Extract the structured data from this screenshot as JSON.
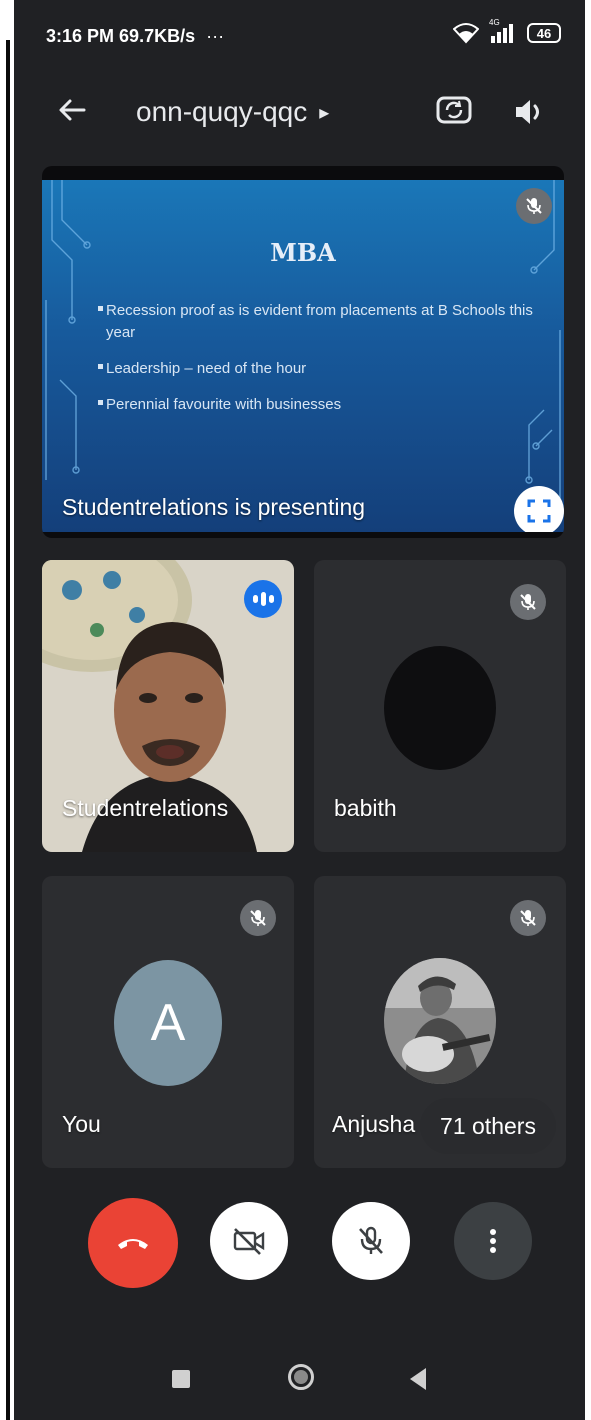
{
  "status_bar": {
    "time": "3:16 PM",
    "network_speed": "69.7KB/s",
    "more_indicator": "···",
    "network_type": "4G",
    "battery": "46"
  },
  "app_bar": {
    "meeting_code": "onn-quqy-qqc",
    "meeting_code_arrow": "▸",
    "icons": [
      "back-arrow-icon",
      "switch-camera-icon",
      "speaker-icon"
    ]
  },
  "presentation": {
    "slide_title": "MBA",
    "bullets": [
      "Recession proof as is evident from placements at B Schools this year",
      "Leadership – need of the hour",
      "Perennial favourite with businesses"
    ],
    "presenting_label": "Studentrelations is presenting",
    "muted": true
  },
  "participants": [
    {
      "name": "Studentrelations",
      "state": "speaking",
      "video": true
    },
    {
      "name": "babith",
      "state": "muted",
      "video": false
    },
    {
      "name": "You",
      "state": "muted",
      "avatar_letter": "A",
      "avatar_color": "#7c95a3"
    },
    {
      "name": "Anjusha",
      "state": "muted",
      "video": false
    }
  ],
  "others_chip": "71 others",
  "controls": [
    {
      "name": "end-call",
      "color": "#ea4335"
    },
    {
      "name": "camera-off",
      "color": "#ffffff"
    },
    {
      "name": "mic-off",
      "color": "#ffffff"
    },
    {
      "name": "more-options",
      "color": "#3c4043"
    }
  ],
  "colors": {
    "background": "#202124",
    "tile": "#2c2d30",
    "accent_blue": "#1a73e8",
    "end_call_red": "#ea4335"
  }
}
